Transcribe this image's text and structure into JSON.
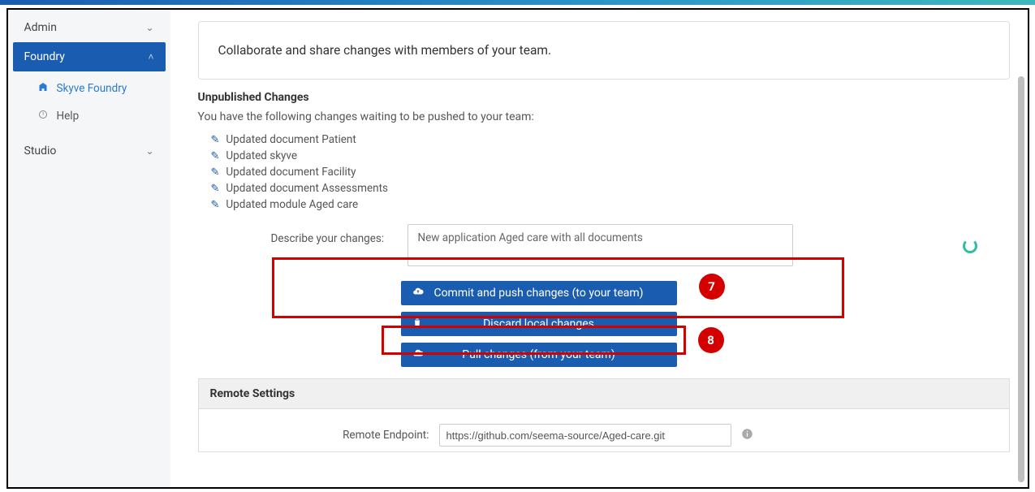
{
  "sidebar": {
    "admin": {
      "label": "Admin"
    },
    "foundry": {
      "label": "Foundry",
      "items": [
        {
          "icon": "building-icon",
          "label": "Skyve Foundry"
        },
        {
          "icon": "help-icon",
          "label": "Help"
        }
      ]
    },
    "studio": {
      "label": "Studio"
    }
  },
  "banner": {
    "text": "Collaborate and share changes with members of your team."
  },
  "unpublished": {
    "heading": "Unpublished Changes",
    "intro": "You have the following changes waiting to be pushed to your team:",
    "items": [
      "Updated document Patient",
      "Updated skyve",
      "Updated document Facility",
      "Updated document Assessments",
      "Updated module Aged care"
    ]
  },
  "describe": {
    "label": "Describe your changes:",
    "value": "New application Aged care with all documents"
  },
  "buttons": {
    "commit": "Commit and push changes (to your team)",
    "discard": "Discard local changes",
    "pull": "Pull changes (from your team)"
  },
  "remote": {
    "heading": "Remote Settings",
    "endpoint_label": "Remote Endpoint:",
    "endpoint_value": "https://github.com/seema-source/Aged-care.git"
  },
  "annotations": {
    "b7": "7",
    "b8": "8"
  },
  "colors": {
    "primary": "#1a5cb0",
    "accent_red": "#d40000",
    "spinner": "#2fbf9e"
  }
}
